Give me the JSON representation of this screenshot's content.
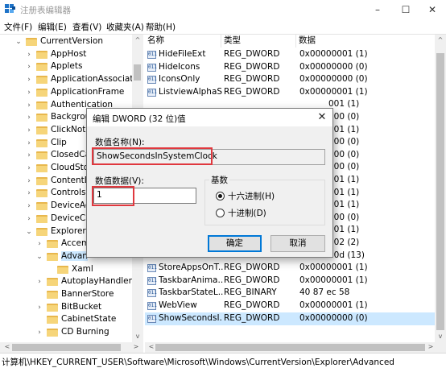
{
  "window": {
    "title": "注册表编辑器",
    "minimize": "–",
    "maximize": "☐",
    "close": "✕"
  },
  "menu": [
    "文件(F)",
    "编辑(E)",
    "查看(V)",
    "收藏夹(A)",
    "帮助(H)"
  ],
  "tree": [
    {
      "label": "CurrentVersion",
      "expanded": true
    },
    {
      "label": "AppHost"
    },
    {
      "label": "Applets"
    },
    {
      "label": "ApplicationAssociatic"
    },
    {
      "label": "ApplicationFrame"
    },
    {
      "label": "Authentication"
    },
    {
      "label": "Backgrou"
    },
    {
      "label": "ClickNote"
    },
    {
      "label": "Clip"
    },
    {
      "label": "ClosedCa"
    },
    {
      "label": "CloudSto"
    },
    {
      "label": "ContentD"
    },
    {
      "label": "Controls"
    },
    {
      "label": "DeviceAc"
    },
    {
      "label": "DeviceCa"
    },
    {
      "label": "Explorer",
      "expanded": true
    },
    {
      "label": "Accem"
    },
    {
      "label": "Advan",
      "expanded": true,
      "selected": true
    },
    {
      "label": "Xaml"
    },
    {
      "label": "AutoplayHandlers"
    },
    {
      "label": "BannerStore"
    },
    {
      "label": "BitBucket"
    },
    {
      "label": "CabinetState"
    },
    {
      "label": "CD Burning"
    }
  ],
  "columns": {
    "name": "名称",
    "type": "类型",
    "data": "数据"
  },
  "values": [
    {
      "name": "HideFileExt",
      "type": "REG_DWORD",
      "data": "0x00000001 (1)"
    },
    {
      "name": "HideIcons",
      "type": "REG_DWORD",
      "data": "0x00000000 (0)"
    },
    {
      "name": "IconsOnly",
      "type": "REG_DWORD",
      "data": "0x00000000 (0)"
    },
    {
      "name": "ListviewAlphaS...",
      "type": "REG_DWORD",
      "data": "0x00000001 (1)"
    },
    {
      "name": "",
      "type": "",
      "data": "001 (1)"
    },
    {
      "name": "",
      "type": "",
      "data": "000 (0)"
    },
    {
      "name": "",
      "type": "",
      "data": "001 (1)"
    },
    {
      "name": "",
      "type": "",
      "data": "000 (0)"
    },
    {
      "name": "",
      "type": "",
      "data": "000 (0)"
    },
    {
      "name": "",
      "type": "",
      "data": "000 (0)"
    },
    {
      "name": "",
      "type": "",
      "data": "001 (1)"
    },
    {
      "name": "",
      "type": "",
      "data": "001 (1)"
    },
    {
      "name": "",
      "type": "",
      "data": "001 (1)"
    },
    {
      "name": "",
      "type": "",
      "data": "000 (0)"
    },
    {
      "name": "",
      "type": "",
      "data": "001 (1)"
    },
    {
      "name": "",
      "type": "",
      "data": "002 (2)"
    },
    {
      "name": "",
      "type": "",
      "data": "00d (13)"
    },
    {
      "name": "StoreAppsOnT...",
      "type": "REG_DWORD",
      "data": "0x00000001 (1)"
    },
    {
      "name": "TaskbarAnima...",
      "type": "REG_DWORD",
      "data": "0x00000001 (1)"
    },
    {
      "name": "TaskbarStateL...",
      "type": "REG_BINARY",
      "data": "40 87 ec 58"
    },
    {
      "name": "WebView",
      "type": "REG_DWORD",
      "data": "0x00000001 (1)"
    },
    {
      "name": "ShowSecondsI...",
      "type": "REG_DWORD",
      "data": "0x00000000 (0)",
      "selected": true
    }
  ],
  "status_path": "计算机\\HKEY_CURRENT_USER\\Software\\Microsoft\\Windows\\CurrentVersion\\Explorer\\Advanced",
  "dialog": {
    "title": "编辑 DWORD (32 位)值",
    "close": "✕",
    "name_label": "数值名称(N):",
    "name_value": "ShowSecondsInSystemClock",
    "data_label": "数值数据(V):",
    "data_value": "1",
    "base_label": "基数",
    "hex_label": "十六进制(H)",
    "dec_label": "十进制(D)",
    "selected_base": "hex",
    "ok": "确定",
    "cancel": "取消"
  },
  "colors": {
    "highlight": "#e0383e",
    "selection": "#cce8ff",
    "default_button_border": "#0078d7"
  }
}
